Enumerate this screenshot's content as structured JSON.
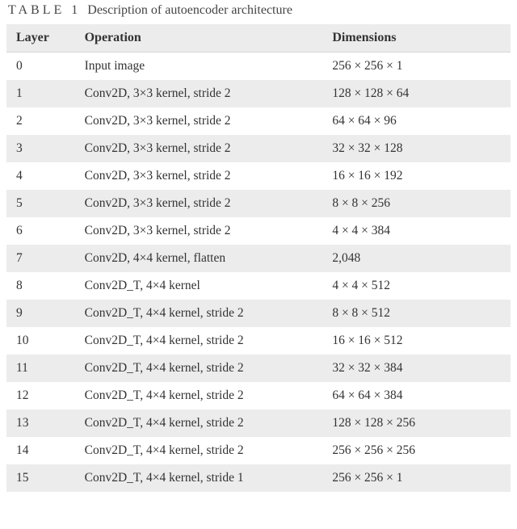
{
  "table": {
    "label": "TABLE 1",
    "caption": "Description of autoencoder architecture",
    "columns": [
      "Layer",
      "Operation",
      "Dimensions"
    ]
  },
  "chart_data": {
    "type": "table",
    "title": "Description of autoencoder architecture",
    "columns": [
      "Layer",
      "Operation",
      "Dimensions"
    ],
    "rows": [
      {
        "layer": "0",
        "operation": "Input image",
        "dimensions": "256 × 256 × 1"
      },
      {
        "layer": "1",
        "operation": "Conv2D, 3×3 kernel, stride 2",
        "dimensions": "128 × 128 × 64"
      },
      {
        "layer": "2",
        "operation": "Conv2D, 3×3 kernel, stride 2",
        "dimensions": "64 × 64 × 96"
      },
      {
        "layer": "3",
        "operation": "Conv2D, 3×3 kernel, stride 2",
        "dimensions": "32 × 32 × 128"
      },
      {
        "layer": "4",
        "operation": "Conv2D, 3×3 kernel, stride 2",
        "dimensions": "16 × 16 × 192"
      },
      {
        "layer": "5",
        "operation": "Conv2D, 3×3 kernel, stride 2",
        "dimensions": "8 × 8 × 256"
      },
      {
        "layer": "6",
        "operation": "Conv2D, 3×3 kernel, stride 2",
        "dimensions": "4 × 4 × 384"
      },
      {
        "layer": "7",
        "operation": "Conv2D, 4×4 kernel, flatten",
        "dimensions": "2,048"
      },
      {
        "layer": "8",
        "operation": "Conv2D_T, 4×4 kernel",
        "dimensions": "4 × 4 × 512"
      },
      {
        "layer": "9",
        "operation": "Conv2D_T, 4×4 kernel, stride 2",
        "dimensions": "8 × 8 × 512"
      },
      {
        "layer": "10",
        "operation": "Conv2D_T, 4×4 kernel, stride 2",
        "dimensions": "16 × 16 × 512"
      },
      {
        "layer": "11",
        "operation": "Conv2D_T, 4×4 kernel, stride 2",
        "dimensions": "32 × 32 × 384"
      },
      {
        "layer": "12",
        "operation": "Conv2D_T, 4×4 kernel, stride 2",
        "dimensions": "64 × 64 × 384"
      },
      {
        "layer": "13",
        "operation": "Conv2D_T, 4×4 kernel, stride 2",
        "dimensions": "128 × 128 × 256"
      },
      {
        "layer": "14",
        "operation": "Conv2D_T, 4×4 kernel, stride 2",
        "dimensions": "256 × 256 × 256"
      },
      {
        "layer": "15",
        "operation": "Conv2D_T, 4×4 kernel, stride 1",
        "dimensions": "256 × 256 × 1"
      }
    ]
  }
}
